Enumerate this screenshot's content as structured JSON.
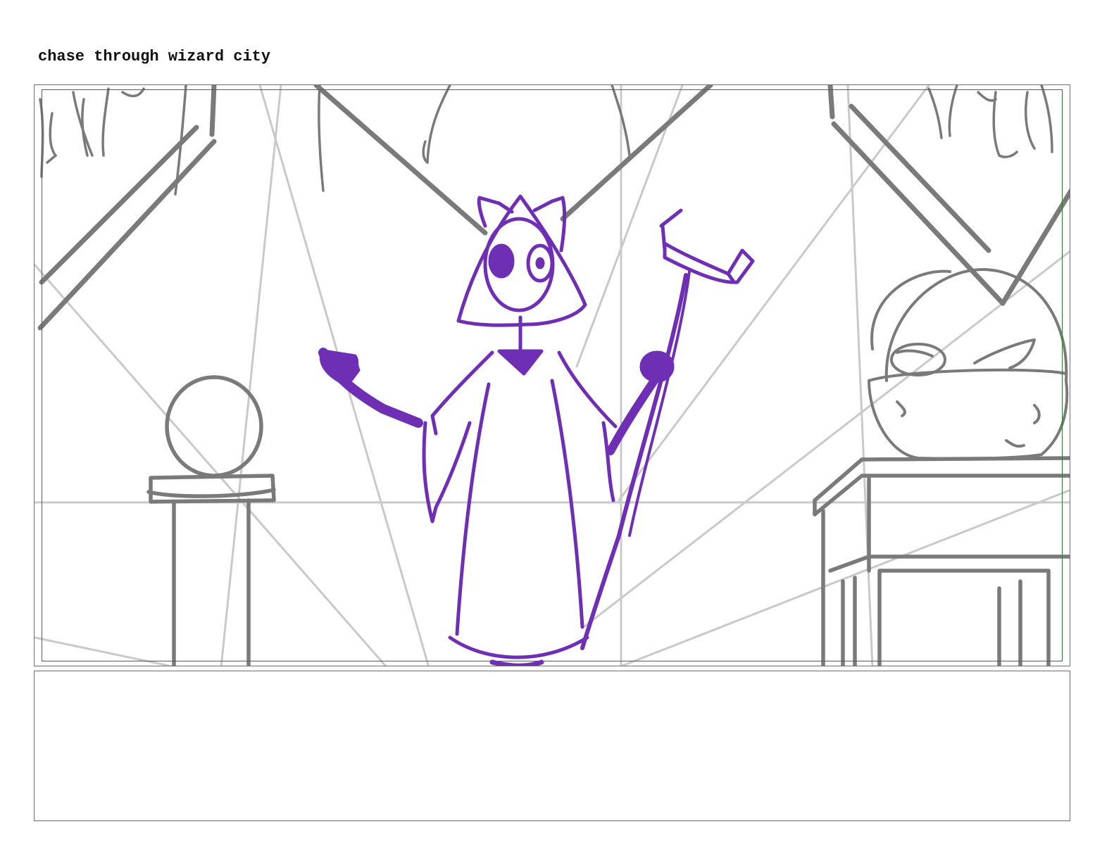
{
  "page": {
    "title": "chase through wizard city"
  },
  "panel": {
    "notes_text": ""
  },
  "colors": {
    "character": "#6e2fb5",
    "sketch_dark": "#7a7a7a",
    "sketch_light": "#c8c8c8",
    "safe_area": "#2f7a2f",
    "frame": "#6e6e6e"
  }
}
